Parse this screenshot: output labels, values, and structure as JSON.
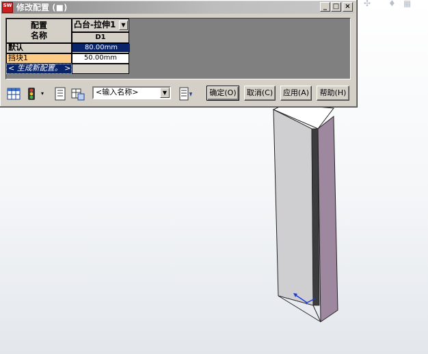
{
  "window": {
    "title": "修改配置 (■)",
    "icon_label": "SW"
  },
  "table": {
    "name_header": "配置\n名称",
    "feature_header": "凸台-拉伸1",
    "dimension_header": "D1",
    "rows": [
      {
        "name": "默认",
        "value": "80.00mm"
      },
      {
        "name": "挡块1",
        "value": "50.00mm"
      },
      {
        "name": "< 生成新配置。 >",
        "value": ""
      }
    ]
  },
  "toolbar": {
    "name_input_value": "<输入名称>",
    "ok_label": "确定(O)",
    "cancel_label": "取消(C)",
    "apply_label": "应用(A)",
    "help_label": "帮助(H)"
  },
  "colors": {
    "selection": "#0a246a",
    "highlight_row": "#ffcc88",
    "part_side": "#9d88a0"
  }
}
